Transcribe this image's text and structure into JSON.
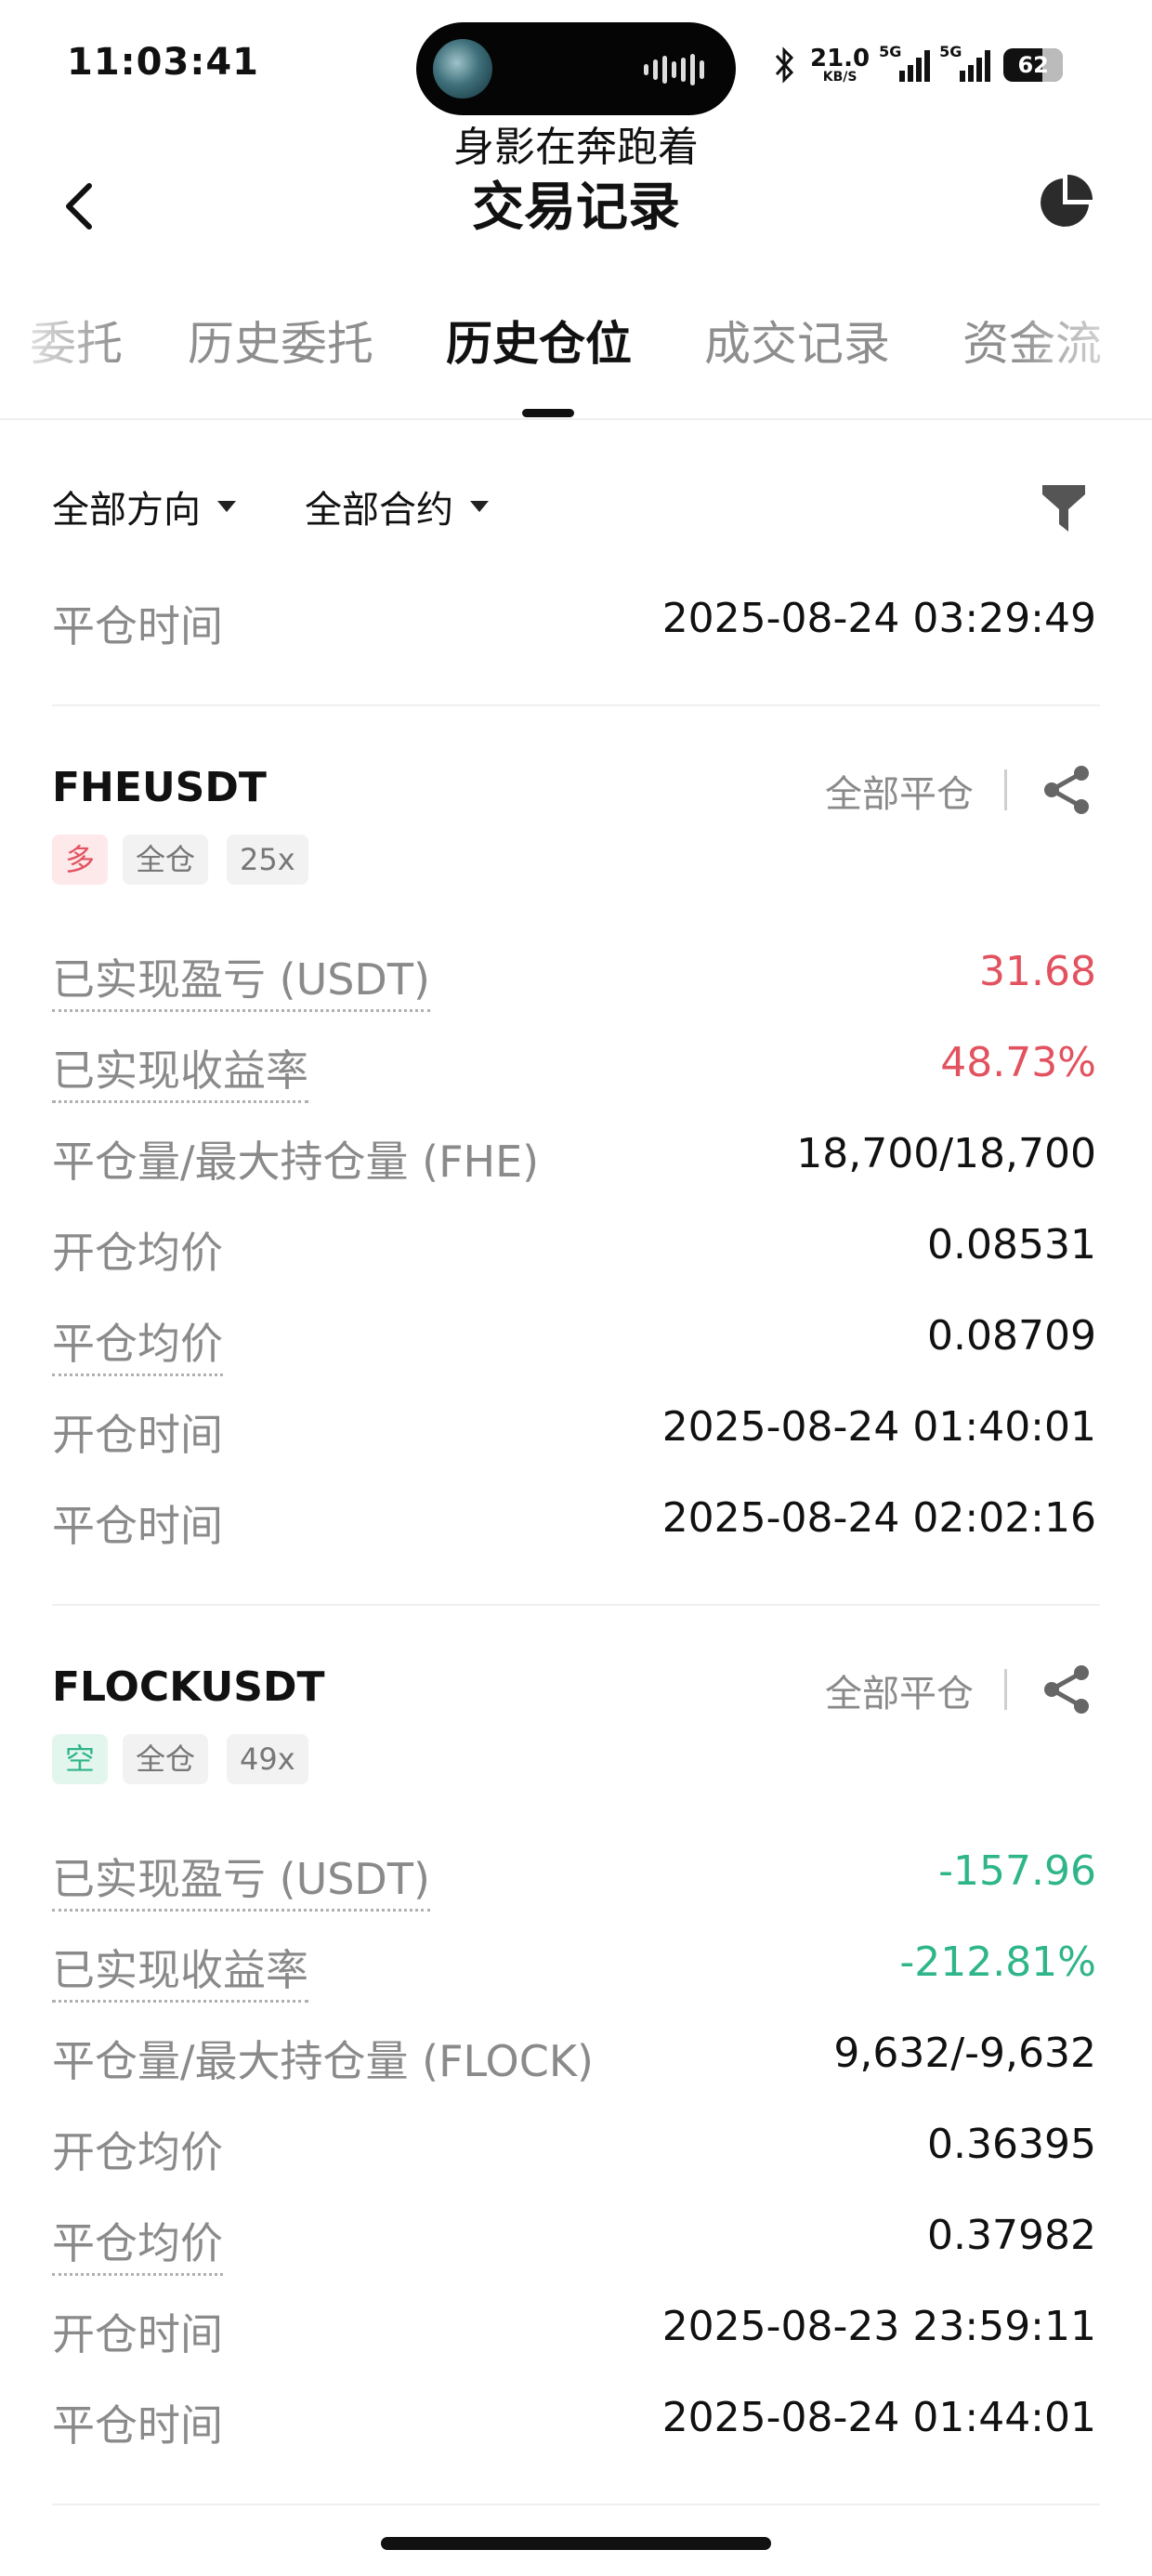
{
  "status_bar": {
    "time": "11:03:41",
    "net_speed": "21.0",
    "net_unit": "KB/S",
    "sig1_tag": "5G",
    "sig2_tag": "5G",
    "battery": "62"
  },
  "header": {
    "subtitle": "身影在奔跑着",
    "title": "交易记录"
  },
  "tabs": [
    {
      "label": "委托"
    },
    {
      "label": "历史委托"
    },
    {
      "label": "历史仓位"
    },
    {
      "label": "成交记录"
    },
    {
      "label": "资金流"
    }
  ],
  "filters": {
    "direction": "全部方向",
    "contract": "全部合约"
  },
  "top_row": {
    "label": "平仓时间",
    "value": "2025-08-24 03:29:49"
  },
  "positions": [
    {
      "symbol": "FHEUSDT",
      "side": "多",
      "margin_mode": "全仓",
      "leverage": "25x",
      "action": "全部平仓",
      "rows": [
        {
          "label": "已实现盈亏 (USDT)",
          "value": "31.68"
        },
        {
          "label": "已实现收益率",
          "value": "48.73%"
        },
        {
          "label": "平仓量/最大持仓量 (FHE)",
          "value": "18,700/18,700"
        },
        {
          "label": "开仓均价",
          "value": "0.08531"
        },
        {
          "label": "平仓均价",
          "value": "0.08709"
        },
        {
          "label": "开仓时间",
          "value": "2025-08-24 01:40:01"
        },
        {
          "label": "平仓时间",
          "value": "2025-08-24 02:02:16"
        }
      ]
    },
    {
      "symbol": "FLOCKUSDT",
      "side": "空",
      "margin_mode": "全仓",
      "leverage": "49x",
      "action": "全部平仓",
      "rows": [
        {
          "label": "已实现盈亏 (USDT)",
          "value": "-157.96"
        },
        {
          "label": "已实现收益率",
          "value": "-212.81%"
        },
        {
          "label": "平仓量/最大持仓量 (FLOCK)",
          "value": "9,632/-9,632"
        },
        {
          "label": "开仓均价",
          "value": "0.36395"
        },
        {
          "label": "平仓均价",
          "value": "0.37982"
        },
        {
          "label": "开仓时间",
          "value": "2025-08-23 23:59:11"
        },
        {
          "label": "平仓时间",
          "value": "2025-08-24 01:44:01"
        }
      ]
    }
  ],
  "colors": {
    "profit": "#e2525f",
    "loss": "#2fb58a"
  }
}
